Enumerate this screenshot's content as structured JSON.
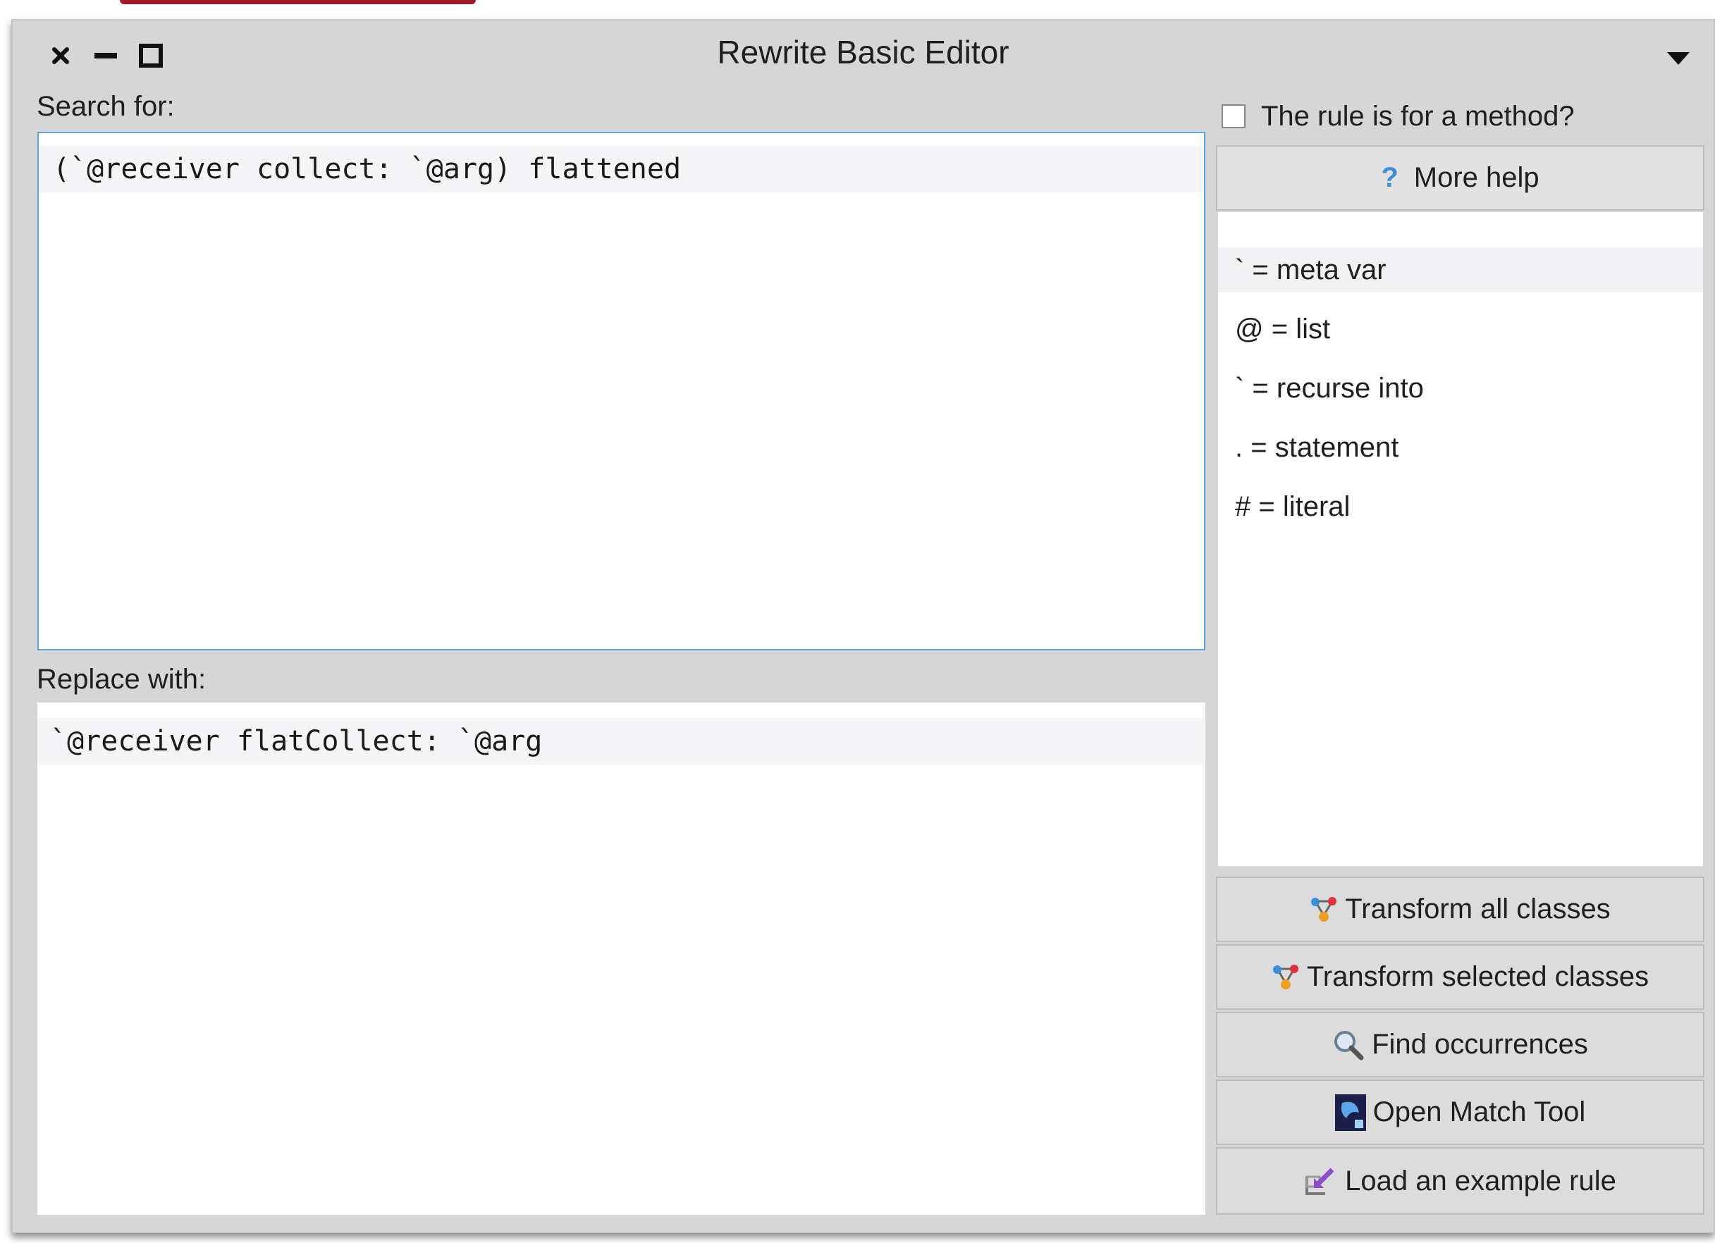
{
  "window": {
    "title": "Rewrite Basic Editor"
  },
  "search": {
    "label": "Search for:",
    "code": "(`@receiver collect: `@arg) flattened"
  },
  "replace": {
    "label": "Replace with:",
    "code": "`@receiver flatCollect: `@arg"
  },
  "method_rule": {
    "label": "The rule is for a method?",
    "checked": false
  },
  "help": {
    "button_label": "More help",
    "button_icon": "question-icon",
    "items": [
      {
        "text": "` = meta var"
      },
      {
        "text": "@ = list"
      },
      {
        "text": "` = recurse into"
      },
      {
        "text": ". = statement"
      },
      {
        "text": "# = literal"
      }
    ]
  },
  "actions": [
    {
      "label": "Transform all classes",
      "icon": "transform-icon"
    },
    {
      "label": "Transform selected classes",
      "icon": "transform-icon"
    },
    {
      "label": "Find occurrences",
      "icon": "magnifier-icon"
    },
    {
      "label": "Open Match Tool",
      "icon": "match-tool-icon"
    },
    {
      "label": "Load an example rule",
      "icon": "load-example-icon"
    }
  ],
  "colors": {
    "accent": "#5ea3e6",
    "window_bg": "#d6d6d6",
    "help_icon": "#3a8fd6"
  }
}
